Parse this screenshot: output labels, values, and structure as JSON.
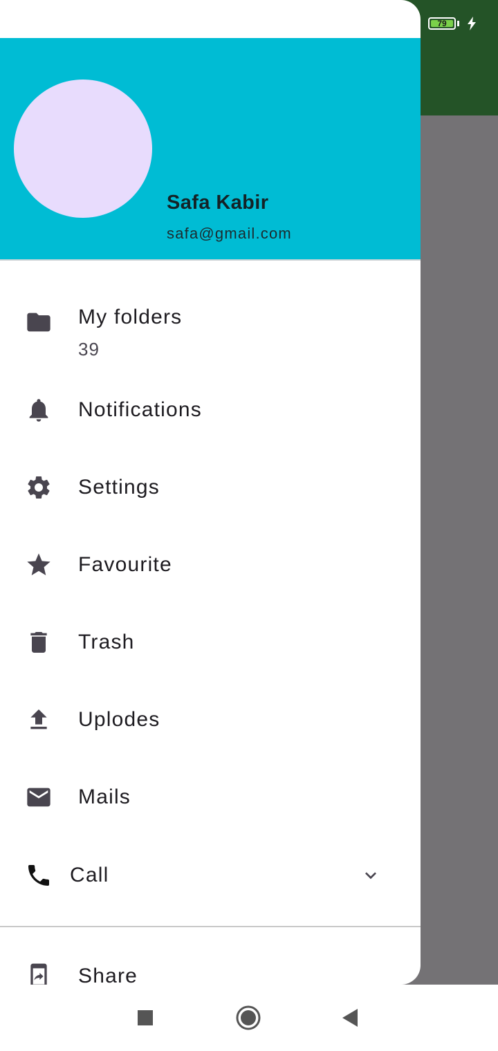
{
  "status_bar": {
    "battery_level": "79"
  },
  "header": {
    "name": "Safa Kabir",
    "email": "safa@gmail.com"
  },
  "menu": {
    "items": [
      {
        "label": "My folders",
        "sub": "39",
        "icon": "folder-icon"
      },
      {
        "label": "Notifications",
        "icon": "bell-icon"
      },
      {
        "label": "Settings",
        "icon": "gear-icon"
      },
      {
        "label": "Favourite",
        "icon": "star-icon"
      },
      {
        "label": "Trash",
        "icon": "trash-icon"
      },
      {
        "label": "Uplodes",
        "icon": "upload-icon"
      },
      {
        "label": "Mails",
        "icon": "mail-icon"
      },
      {
        "label": "Call",
        "icon": "phone-icon"
      },
      {
        "label": "Share",
        "icon": "share-icon"
      }
    ]
  },
  "colors": {
    "header_bg": "#00bcd4",
    "avatar_bg": "#e8dcfd",
    "app_bar_bg": "#245327",
    "scrim": "#747275",
    "icon": "#49454f"
  }
}
